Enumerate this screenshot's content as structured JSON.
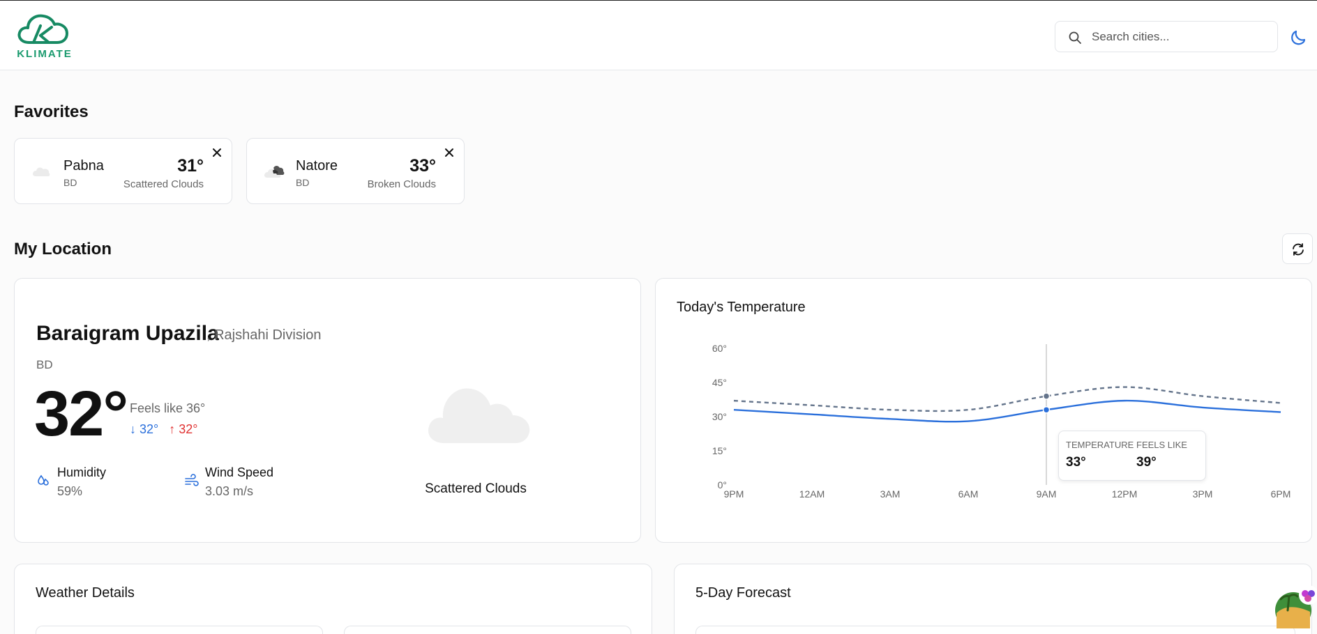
{
  "app": {
    "name": "KLIMATE",
    "accent_color": "#1a9a6e",
    "primary_color": "#2a6fdb"
  },
  "header": {
    "search_placeholder": "Search cities..."
  },
  "favorites": {
    "title": "Favorites",
    "items": [
      {
        "city": "Pabna",
        "country": "BD",
        "temp": "31°",
        "description": "Scattered Clouds",
        "icon": "scattered-clouds-icon"
      },
      {
        "city": "Natore",
        "country": "BD",
        "temp": "33°",
        "description": "Broken Clouds",
        "icon": "broken-clouds-icon"
      }
    ]
  },
  "my_location": {
    "title": "My Location",
    "city": "Baraigram Upazila",
    "region": ", Rajshahi Division",
    "country": "BD",
    "temp": "32°",
    "feels_like": "Feels like 36°",
    "temp_min": "32°",
    "temp_max": "32°",
    "humidity_label": "Humidity",
    "humidity_value": "59%",
    "wind_label": "Wind Speed",
    "wind_value": "3.03 m/s",
    "condition": "Scattered Clouds"
  },
  "todays_temperature": {
    "title": "Today's Temperature",
    "tooltip": {
      "temp_label": "TEMPERATURE",
      "feels_label": "FEELS LIKE",
      "temp_value": "33°",
      "feels_value": "39°"
    }
  },
  "chart_data": {
    "type": "line",
    "title": "Today's Temperature",
    "x": [
      "9PM",
      "12AM",
      "3AM",
      "6AM",
      "9AM",
      "12PM",
      "3PM",
      "6PM"
    ],
    "y_ticks": [
      "0°",
      "15°",
      "30°",
      "45°",
      "60°"
    ],
    "ylim": [
      0,
      60
    ],
    "grid": false,
    "series": [
      {
        "name": "Temperature",
        "values": [
          33,
          31,
          29,
          28,
          33,
          37,
          34,
          32
        ],
        "color": "#2a6fdb",
        "style": "solid"
      },
      {
        "name": "Feels Like",
        "values": [
          37,
          35,
          33,
          33,
          39,
          43,
          39,
          36
        ],
        "color": "#64748b",
        "style": "dashed"
      }
    ],
    "highlight_x": "9AM"
  },
  "weather_details": {
    "title": "Weather Details"
  },
  "forecast": {
    "title": "5-Day Forecast"
  }
}
